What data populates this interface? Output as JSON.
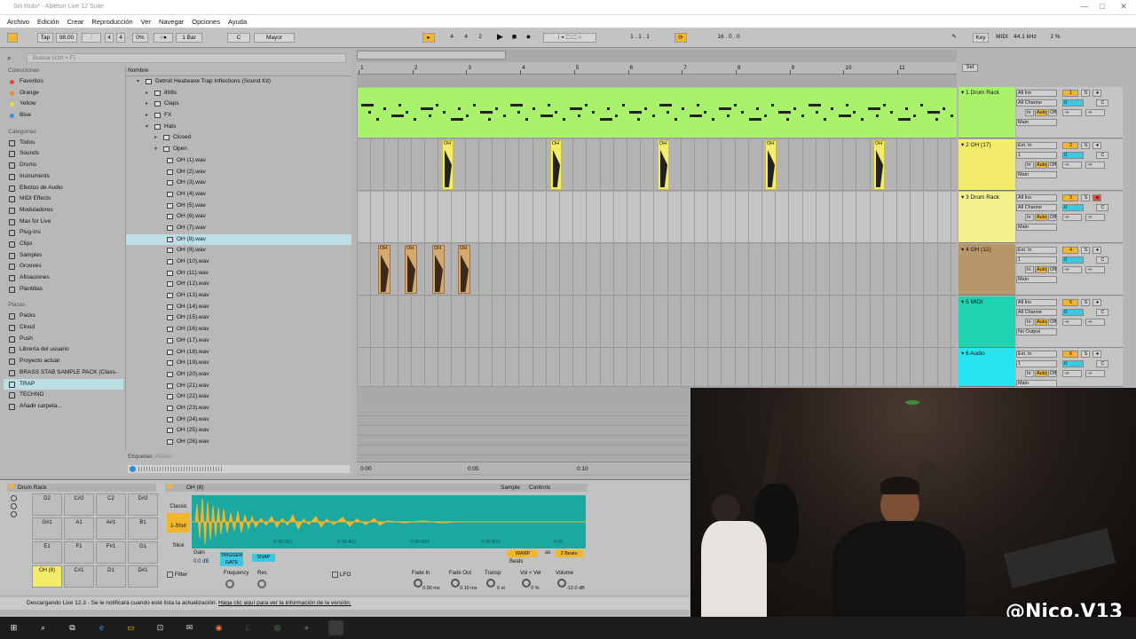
{
  "window": {
    "title": "Sin título* - Ableton Live 12 Suite",
    "min": "—",
    "max": "□",
    "close": "✕"
  },
  "menu": [
    "Archivo",
    "Edición",
    "Crear",
    "Reproducción",
    "Ver",
    "Navegar",
    "Opciones",
    "Ayuda"
  ],
  "control": {
    "tap": "Tap",
    "tempo": "98.00",
    "sig_num": "4",
    "sig_den": "4",
    "swing": "0%",
    "quant": "1 Bar",
    "key": "C",
    "scale": "Mayor",
    "pos1": "4",
    "pos2": "4",
    "pos3": "2",
    "loop_pos": "1 . 1 . 1",
    "loop_len": "16 . 0 . 0",
    "key_label": "Key",
    "midi_label": "MIDI",
    "sample_rate": "44.1 kHz",
    "cpu": "2 %"
  },
  "browser": {
    "search_placeholder": "Buscar (Ctrl + F)",
    "name_col": "Nombre",
    "etiquetas_label": "Etiquetas:",
    "etiquetas_value": "Añadir..."
  },
  "sidebar": {
    "colecciones_title": "Colecciones",
    "colecciones": [
      {
        "label": "Favoritos",
        "color": "#e24a3b"
      },
      {
        "label": "Orange",
        "color": "#ee8a2a"
      },
      {
        "label": "Yellow",
        "color": "#f1d93a"
      },
      {
        "label": "Blue",
        "color": "#3c8de0"
      }
    ],
    "categorias_title": "Categorías",
    "categorias": [
      "Todos",
      "Sounds",
      "Drums",
      "Instruments",
      "Efectos de Audio",
      "MIDI Effects",
      "Moduladores",
      "Max for Live",
      "Plug-Ins",
      "Clips",
      "Samples",
      "Grooves",
      "Afinaciones",
      "Plantillas"
    ],
    "places_title": "Places",
    "places": [
      "Packs",
      "Cloud",
      "Push",
      "Librería del usuario",
      "Proyecto actual",
      "BRASS STAB SAMPLE PACK (Class-",
      "TRAP",
      "TECHNO",
      "Añadir carpeta..."
    ]
  },
  "files": {
    "root": "Detroit Heatwave Trap Inflections (Sound Kit)",
    "folders": [
      "808s",
      "Claps",
      "FX",
      "Hats",
      "Closed",
      "Open"
    ],
    "items": [
      "OH (1).wav",
      "OH (2).wav",
      "OH (3).wav",
      "OH (4).wav",
      "OH (5).wav",
      "OH (6).wav",
      "OH (7).wav",
      "OH (8).wav",
      "OH (9).wav",
      "OH (10).wav",
      "OH (11).wav",
      "OH (12).wav",
      "OH (13).wav",
      "OH (14).wav",
      "OH (15).wav",
      "OH (16).wav",
      "OH (17).wav",
      "OH (18).wav",
      "OH (19).wav",
      "OH (20).wav",
      "OH (21).wav",
      "OH (22).wav",
      "OH (23).wav",
      "OH (24).wav",
      "OH (25).wav",
      "OH (26).wav"
    ]
  },
  "ruler": {
    "marks": [
      "1",
      "2",
      "3",
      "4",
      "5",
      "6",
      "7",
      "8",
      "9",
      "10",
      "11"
    ],
    "set_label": "Set",
    "time_marks": [
      "0:00",
      "0:05",
      "0:10"
    ]
  },
  "tracks": [
    {
      "name": "1 Drum Rack",
      "color": "#a8f36a",
      "input": "All Ins",
      "channel": "All Channe",
      "monitor": [
        "In",
        "Auto",
        "Off"
      ],
      "out": "Main",
      "num": "1",
      "clip_label": ""
    },
    {
      "name": "2 OH (17)",
      "color": "#f3ec6a",
      "input": "Ext. In",
      "channel": "1",
      "monitor": [
        "In",
        "Auto",
        "Off"
      ],
      "out": "Main",
      "num": "2",
      "clip_label": "OH"
    },
    {
      "name": "3 Drum Rack",
      "color": "#f3f08e",
      "input": "All Ins",
      "channel": "All Channe",
      "monitor": [
        "In",
        "Auto",
        "Off"
      ],
      "out": "Main",
      "num": "3",
      "clip_label": ""
    },
    {
      "name": "4 OH (12)",
      "color": "#b9966a",
      "input": "Ext. In",
      "channel": "1",
      "monitor": [
        "In",
        "Auto",
        "Off"
      ],
      "out": "Main",
      "num": "4",
      "clip_label": "OH"
    },
    {
      "name": "5 MIDI",
      "color": "#1fd3b0",
      "input": "All Ins",
      "channel": "All Channe",
      "monitor": [
        "In",
        "Auto",
        "Off"
      ],
      "out": "No Output",
      "num": "5",
      "clip_label": ""
    },
    {
      "name": "6 Audio",
      "color": "#26e5f0",
      "input": "Ext. In",
      "channel": "1",
      "monitor": [
        "In",
        "Auto",
        "Off"
      ],
      "out": "Main",
      "num": "6",
      "clip_label": ""
    }
  ],
  "mixer_common": {
    "solo": "S",
    "send": "-∞",
    "vol": "0",
    "pan": "C"
  },
  "detail": {
    "drum_rack_title": "Drum Rack",
    "pads": [
      "D2",
      "C#2",
      "C2",
      "D#2",
      "G#1",
      "A1",
      "A#1",
      "B1",
      "E1",
      "F1",
      "F#1",
      "G1",
      "OH (8)",
      "C#1",
      "D1",
      "D#1"
    ],
    "sample_title": "OH (8)",
    "tabs": [
      "Sample",
      "Controls"
    ],
    "modes": [
      "Classic",
      "1-Shot",
      "Slice"
    ],
    "gain_label": "Gain",
    "gain_value": "0.0 dB",
    "trigger": "TRIGGER",
    "gate": "GATE",
    "snap": "SNAP",
    "warp": "WARP",
    "as_label": "as",
    "beats_value": "2 Beats",
    "beats_mode": "Beats",
    "time_ticks": [
      "0:00:200",
      "0:00:400",
      "0:00:600",
      "0:00:800",
      "0:01"
    ],
    "filter": "Filter",
    "frequency": "Frequency",
    "res": "Res",
    "lfo": "LFO",
    "fade_in": "Fade In",
    "fade_in_value": "0.00 ms",
    "fade_out": "Fade Out",
    "fade_out_value": "0.10 ms",
    "transp": "Transp",
    "transp_value": "0 st",
    "vol_vel": "Vol < Vel",
    "vol_vel_value": "0 %",
    "volume": "Volume",
    "volume_value": "-12.0 dB"
  },
  "status": "Descargando Live 12.3 - Se le notificará cuando esté lista la actualización.",
  "status_link": "Haga clic aquí para ver la información de la versión.",
  "webcam": {
    "watermark": "@Nico.V13"
  },
  "taskbar": [
    "windows-icon",
    "search-icon",
    "task-view-icon",
    "edge-icon",
    "explorer-icon",
    "store-icon",
    "mail-icon",
    "firefox-icon",
    "live-icon",
    "chrome-icon",
    "obs-icon",
    "live-active-icon"
  ]
}
